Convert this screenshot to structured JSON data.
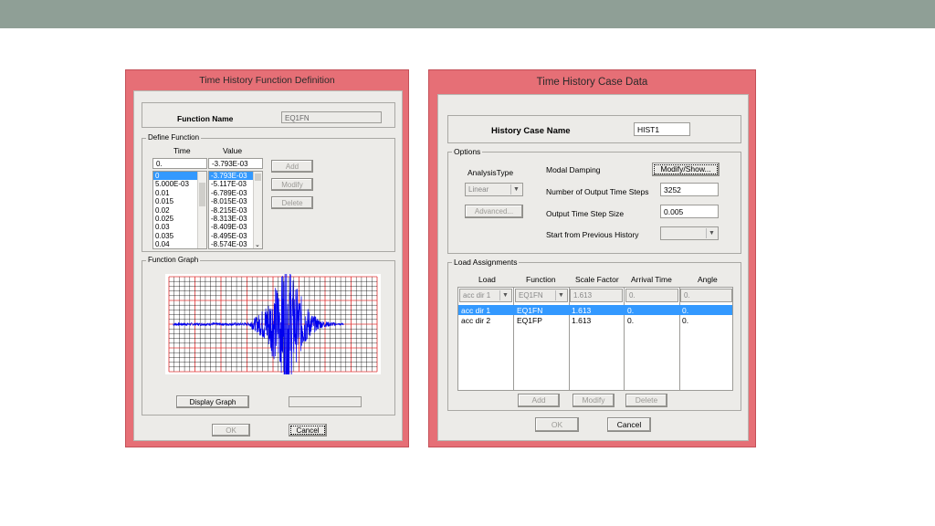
{
  "left_dialog": {
    "title": "Time History  Function Definition",
    "function_name_label": "Function Name",
    "function_name_value": "EQ1FN",
    "define_group_label": "Define Function",
    "col_time": "Time",
    "col_value": "Value",
    "time_input": "0.",
    "value_input": "-3.793E-03",
    "time_list": [
      "0",
      "5.000E-03",
      "0.01",
      "0.015",
      "0.02",
      "0.025",
      "0.03",
      "0.035",
      "0.04"
    ],
    "value_list": [
      "-3.793E-03",
      "-5.117E-03",
      "-6.789E-03",
      "-8.015E-03",
      "-8.215E-03",
      "-8.313E-03",
      "-8.409E-03",
      "-8.495E-03",
      "-8.574E-03"
    ],
    "add_label": "Add",
    "modify_label": "Modify",
    "delete_label": "Delete",
    "graph_group_label": "Function Graph",
    "display_graph_label": "Display Graph",
    "ok_label": "OK",
    "cancel_label": "Cancel",
    "colors": {
      "grid_major": "#e03030",
      "grid_minor": "#000000",
      "trace": "#0000ee"
    }
  },
  "right_dialog": {
    "title": "Time History Case Data",
    "history_case_label": "History Case Name",
    "history_case_value": "HIST1",
    "options_label": "Options",
    "analysis_type_label": "AnalysisType",
    "analysis_type_value": "Linear",
    "advanced_label": "Advanced...",
    "modal_damping_label": "Modal Damping",
    "modify_show_label": "Modify/Show...",
    "num_output_label": "Number of Output Time Steps",
    "num_output_value": "3252",
    "output_step_label": "Output Time Step Size",
    "output_step_value": "0.005",
    "start_prev_label": "Start from Previous History",
    "start_prev_value": "",
    "load_assign_label": "Load Assignments",
    "headers": [
      "Load",
      "Function",
      "Scale Factor",
      "Arrival Time",
      "Angle"
    ],
    "edit_row": [
      "acc dir 1",
      "EQ1FN",
      "1.613",
      "0.",
      "0."
    ],
    "rows": [
      [
        "acc dir 1",
        "EQ1FN",
        "1.613",
        "0.",
        "0."
      ],
      [
        "acc dir 2",
        "EQ1FP",
        "1.613",
        "0.",
        "0."
      ]
    ],
    "add_label": "Add",
    "modify_label": "Modify",
    "delete_label": "Delete",
    "ok_label": "OK",
    "cancel_label": "Cancel"
  }
}
